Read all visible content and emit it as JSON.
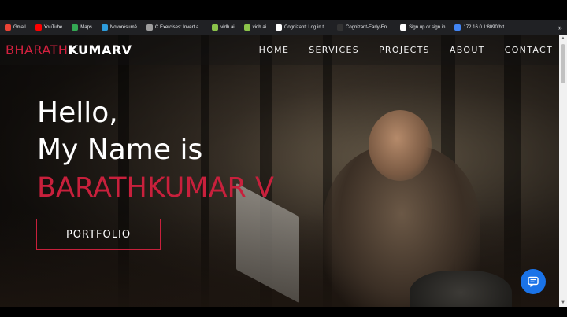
{
  "bookmarks": [
    {
      "label": "Gmail",
      "icon": "gmail-icon",
      "color": "#ea4335"
    },
    {
      "label": "YouTube",
      "icon": "youtube-icon",
      "color": "#ff0000"
    },
    {
      "label": "Maps",
      "icon": "maps-icon",
      "color": "#34a853"
    },
    {
      "label": "Novorésumé",
      "icon": "novoresume-icon",
      "color": "#2d9cdb"
    },
    {
      "label": "C Exercises: Invert a...",
      "icon": "w3-icon",
      "color": "#9e9e9e"
    },
    {
      "label": "vidh.ai",
      "icon": "vidhai-icon",
      "color": "#8bc34a"
    },
    {
      "label": "vidh.ai",
      "icon": "vidhai-icon",
      "color": "#8bc34a"
    },
    {
      "label": "Cognizant: Log in t...",
      "icon": "cognizant-icon",
      "color": "#ffffff"
    },
    {
      "label": "Cognizant-Early-En...",
      "icon": "github-icon",
      "color": "#333333"
    },
    {
      "label": "Sign up or sign in",
      "icon": "globe-icon",
      "color": "#ffffff"
    },
    {
      "label": "172.16.0.1:8090/htt...",
      "icon": "page-icon",
      "color": "#4285f4"
    }
  ],
  "bookmarks_more": "»",
  "brand": {
    "part1": "BHARATH",
    "part2": "KUMARV"
  },
  "nav": [
    "HOME",
    "SERVICES",
    "PROJECTS",
    "ABOUT",
    "CONTACT"
  ],
  "hero": {
    "line1": "Hello,",
    "line2": "My Name is",
    "name": "BARATHKUMAR V"
  },
  "portfolio_button": "PORTFOLIO",
  "colors": {
    "accent": "#c8203c",
    "chat": "#1a73e8"
  }
}
